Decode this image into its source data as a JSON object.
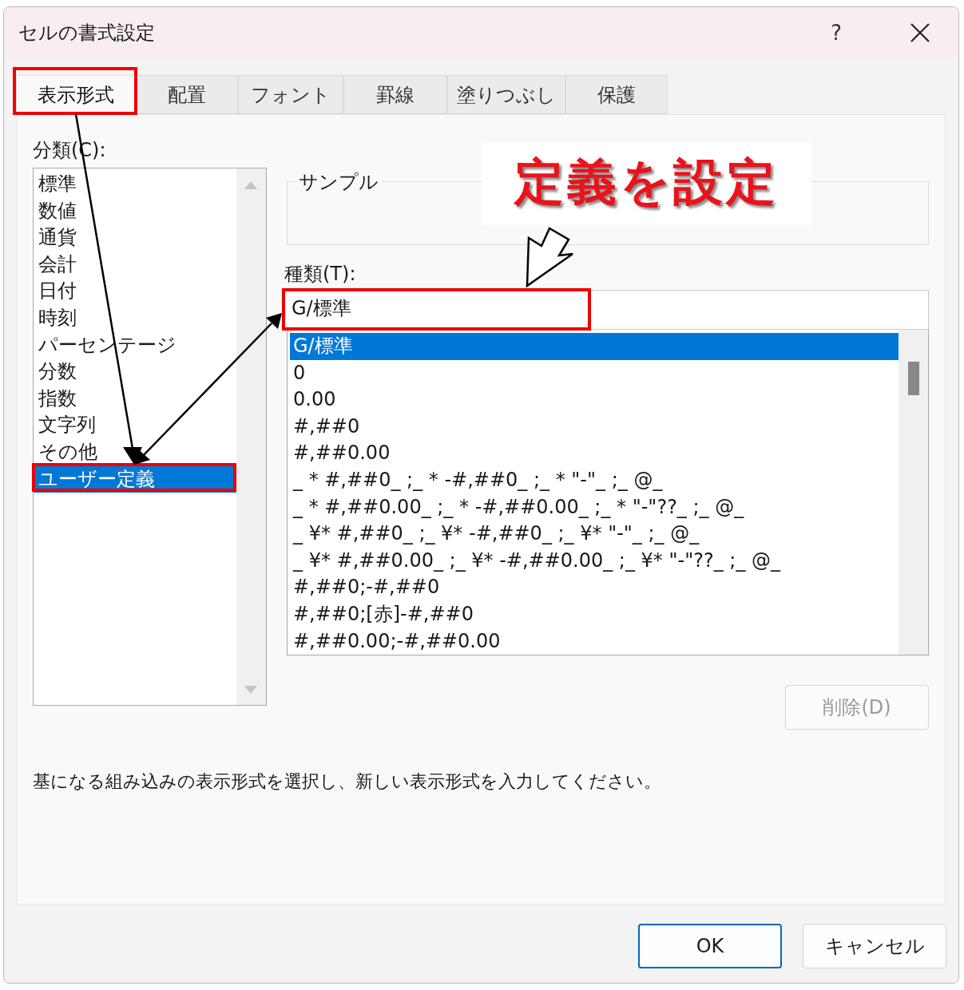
{
  "window": {
    "title": "セルの書式設定",
    "help": "?"
  },
  "tabs": [
    {
      "label": "表示形式",
      "selected": true
    },
    {
      "label": "配置",
      "selected": false
    },
    {
      "label": "フォント",
      "selected": false
    },
    {
      "label": "罫線",
      "selected": false
    },
    {
      "label": "塗りつぶし",
      "selected": false
    },
    {
      "label": "保護",
      "selected": false
    }
  ],
  "category": {
    "label": "分類(C):",
    "items": [
      {
        "label": "標準",
        "selected": false
      },
      {
        "label": "数値",
        "selected": false
      },
      {
        "label": "通貨",
        "selected": false
      },
      {
        "label": "会計",
        "selected": false
      },
      {
        "label": "日付",
        "selected": false
      },
      {
        "label": "時刻",
        "selected": false
      },
      {
        "label": "パーセンテージ",
        "selected": false
      },
      {
        "label": "分数",
        "selected": false
      },
      {
        "label": "指数",
        "selected": false
      },
      {
        "label": "文字列",
        "selected": false
      },
      {
        "label": "その他",
        "selected": false
      },
      {
        "label": "ユーザー定義",
        "selected": true
      }
    ]
  },
  "sample": {
    "legend": "サンプル"
  },
  "annotation": {
    "text": "定義を設定"
  },
  "type": {
    "label": "種類(T):",
    "value": "G/標準",
    "items": [
      {
        "label": "G/標準",
        "selected": true
      },
      {
        "label": "0",
        "selected": false
      },
      {
        "label": "0.00",
        "selected": false
      },
      {
        "label": "#,##0",
        "selected": false
      },
      {
        "label": "#,##0.00",
        "selected": false
      },
      {
        "label": "_ * #,##0_ ;_ * -#,##0_ ;_ * \"-\"_ ;_ @_",
        "selected": false
      },
      {
        "label": "_ * #,##0.00_ ;_ * -#,##0.00_ ;_ * \"-\"??_ ;_ @_",
        "selected": false
      },
      {
        "label": "_ ¥* #,##0_ ;_ ¥* -#,##0_ ;_ ¥* \"-\"_ ;_ @_",
        "selected": false
      },
      {
        "label": "_ ¥* #,##0.00_ ;_ ¥* -#,##0.00_ ;_ ¥* \"-\"??_ ;_ @_",
        "selected": false
      },
      {
        "label": "#,##0;-#,##0",
        "selected": false
      },
      {
        "label": "#,##0;[赤]-#,##0",
        "selected": false
      },
      {
        "label": "#,##0.00;-#,##0.00",
        "selected": false
      }
    ]
  },
  "delete_button": {
    "label": "削除(D)",
    "disabled": true
  },
  "description": "基になる組み込みの表示形式を選択し、新しい表示形式を入力してください。",
  "buttons": [
    {
      "label": "OK",
      "default": true
    },
    {
      "label": "キャンセル",
      "default": false
    }
  ]
}
